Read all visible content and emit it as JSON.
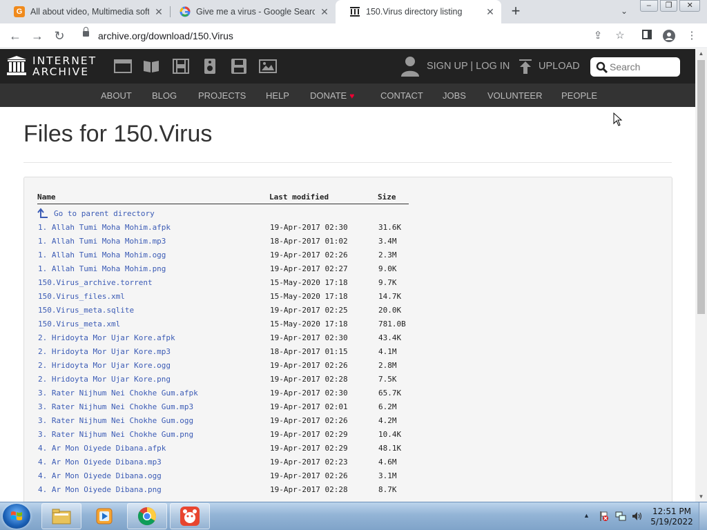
{
  "browser": {
    "tabs": [
      {
        "title": "All about video, Multimedia softw",
        "favicon": "g-orange-icon",
        "active": false
      },
      {
        "title": "Give me a virus - Google Search",
        "favicon": "google-g-icon",
        "active": false
      },
      {
        "title": "150.Virus directory listing",
        "favicon": "archive-icon",
        "active": true
      }
    ],
    "new_tab": "+",
    "url": "archive.org/download/150.Virus"
  },
  "ia_nav": {
    "logo_line1": "INTERNET",
    "logo_line2": "ARCHIVE",
    "media_icons": [
      "web-icon",
      "texts-icon",
      "video-icon",
      "audio-icon",
      "software-icon",
      "images-icon"
    ],
    "signup": "SIGN UP | LOG IN",
    "upload": "UPLOAD",
    "search_placeholder": "Search",
    "sub_links": [
      "ABOUT",
      "BLOG",
      "PROJECTS",
      "HELP",
      "DONATE",
      "CONTACT",
      "JOBS",
      "VOLUNTEER",
      "PEOPLE"
    ]
  },
  "page": {
    "title": "Files for 150.Virus",
    "headers": {
      "name": "Name",
      "modified": "Last modified",
      "size": "Size"
    },
    "parent_link": "Go to parent directory",
    "files": [
      {
        "name": "1. Allah Tumi Moha Mohim.afpk",
        "modified": "19-Apr-2017 02:30",
        "size": "31.6K"
      },
      {
        "name": "1. Allah Tumi Moha Mohim.mp3",
        "modified": "18-Apr-2017 01:02",
        "size": "3.4M"
      },
      {
        "name": "1. Allah Tumi Moha Mohim.ogg",
        "modified": "19-Apr-2017 02:26",
        "size": "2.3M"
      },
      {
        "name": "1. Allah Tumi Moha Mohim.png",
        "modified": "19-Apr-2017 02:27",
        "size": "9.0K"
      },
      {
        "name": "150.Virus_archive.torrent",
        "modified": "15-May-2020 17:18",
        "size": "9.7K"
      },
      {
        "name": "150.Virus_files.xml",
        "modified": "15-May-2020 17:18",
        "size": "14.7K"
      },
      {
        "name": "150.Virus_meta.sqlite",
        "modified": "19-Apr-2017 02:25",
        "size": "20.0K"
      },
      {
        "name": "150.Virus_meta.xml",
        "modified": "15-May-2020 17:18",
        "size": "781.0B"
      },
      {
        "name": "2. Hridoyta Mor Ujar Kore.afpk",
        "modified": "19-Apr-2017 02:30",
        "size": "43.4K"
      },
      {
        "name": "2. Hridoyta Mor Ujar Kore.mp3",
        "modified": "18-Apr-2017 01:15",
        "size": "4.1M"
      },
      {
        "name": "2. Hridoyta Mor Ujar Kore.ogg",
        "modified": "19-Apr-2017 02:26",
        "size": "2.8M"
      },
      {
        "name": "2. Hridoyta Mor Ujar Kore.png",
        "modified": "19-Apr-2017 02:28",
        "size": "7.5K"
      },
      {
        "name": "3. Rater Nijhum Nei Chokhe Gum.afpk",
        "modified": "19-Apr-2017 02:30",
        "size": "65.7K"
      },
      {
        "name": "3. Rater Nijhum Nei Chokhe Gum.mp3",
        "modified": "19-Apr-2017 02:01",
        "size": "6.2M"
      },
      {
        "name": "3. Rater Nijhum Nei Chokhe Gum.ogg",
        "modified": "19-Apr-2017 02:26",
        "size": "4.2M"
      },
      {
        "name": "3. Rater Nijhum Nei Chokhe Gum.png",
        "modified": "19-Apr-2017 02:29",
        "size": "10.4K"
      },
      {
        "name": "4. Ar Mon Oiyede Dibana.afpk",
        "modified": "19-Apr-2017 02:29",
        "size": "48.1K"
      },
      {
        "name": "4. Ar Mon Oiyede Dibana.mp3",
        "modified": "19-Apr-2017 02:23",
        "size": "4.6M"
      },
      {
        "name": "4. Ar Mon Oiyede Dibana.ogg",
        "modified": "19-Apr-2017 02:26",
        "size": "3.1M"
      },
      {
        "name": "4. Ar Mon Oiyede Dibana.png",
        "modified": "19-Apr-2017 02:28",
        "size": "8.7K"
      }
    ]
  },
  "taskbar": {
    "apps": [
      "explorer-icon",
      "media-player-icon",
      "chrome-icon",
      "app-red-icon"
    ],
    "time": "12:51 PM",
    "date": "5/19/2022"
  },
  "colors": {
    "ia_dark": "#222222",
    "ia_sub": "#333333",
    "link": "#3b5bb5",
    "donate_heart": "#ee0033"
  }
}
